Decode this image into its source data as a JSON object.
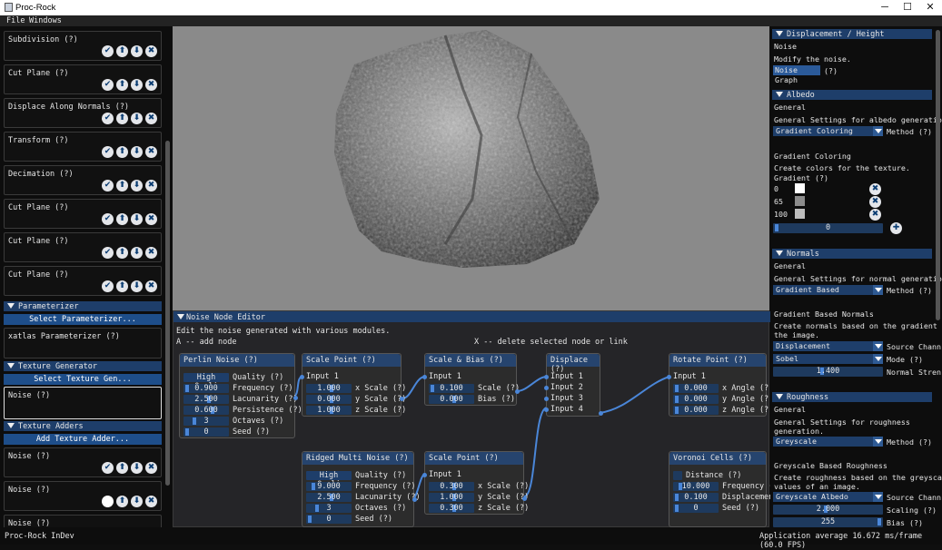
{
  "window": {
    "title": "Proc-Rock",
    "min": "─",
    "max": "☐",
    "close": "✕"
  },
  "menu": [
    "File",
    "Windows"
  ],
  "left": {
    "modifiers": [
      {
        "label": "Subdivision (?)"
      },
      {
        "label": "Cut Plane (?)"
      },
      {
        "label": "Displace Along Normals (?)"
      },
      {
        "label": "Transform (?)"
      },
      {
        "label": "Decimation (?)"
      },
      {
        "label": "Cut Plane (?)"
      },
      {
        "label": "Cut Plane (?)"
      },
      {
        "label": "Cut Plane (?)"
      }
    ],
    "parameterizer": {
      "title": "Parameterizer",
      "button": "Select Parameterizer...",
      "item": "xatlas Parameterizer (?)"
    },
    "texture_generator": {
      "title": "Texture Generator",
      "button": "Select Texture Gen...",
      "item": "Noise (?)"
    },
    "texture_adders": {
      "title": "Texture Adders",
      "button": "Add Texture Adder...",
      "items": [
        "Noise (?)",
        "Noise (?)",
        "Noise (?)"
      ]
    }
  },
  "node_editor": {
    "title": "Noise Node Editor",
    "description": "Edit the noise generated with various modules.",
    "hint_add": "A -- add node",
    "hint_delete": "X -- delete selected node or link",
    "perlin": {
      "title": "Perlin Noise (?)",
      "quality_value": "High Quali",
      "quality_label": "Quality (?)",
      "frequency": "0.900",
      "frequency_label": "Frequency (?)",
      "lacunarity": "2.500",
      "lacunarity_label": "Lacunarity (?)",
      "persistence": "0.600",
      "persistence_label": "Persistence (?)",
      "octaves": "3",
      "octaves_label": "Octaves (?)",
      "seed": "0",
      "seed_label": "Seed (?)"
    },
    "scale_point1": {
      "title": "Scale Point (?)",
      "input": "Input 1",
      "x": "1.000",
      "x_label": "x Scale (?)",
      "y": "0.000",
      "y_label": "y Scale (?)",
      "z": "1.000",
      "z_label": "z Scale (?)"
    },
    "scale_bias": {
      "title": "Scale & Bias (?)",
      "input": "Input 1",
      "scale": "0.100",
      "scale_label": "Scale (?)",
      "bias": "0.000",
      "bias_label": "Bias (?)"
    },
    "displace": {
      "title": "Displace (?)",
      "inputs": [
        "Input 1",
        "Input 2",
        "Input 3",
        "Input 4"
      ]
    },
    "rotate_point": {
      "title": "Rotate Point (?)",
      "input": "Input 1",
      "x": "0.000",
      "x_label": "x Angle (?",
      "y": "0.000",
      "y_label": "y Angle (?",
      "z": "0.000",
      "z_label": "z Angle (?"
    },
    "ridged": {
      "title": "Ridged Multi Noise (?)",
      "quality_value": "High Quali",
      "quality_label": "Quality (?)",
      "frequency": "9.000",
      "frequency_label": "Frequency (?)",
      "lacunarity": "2.500",
      "lacunarity_label": "Lacunarity (?)",
      "octaves": "3",
      "octaves_label": "Octaves (?)",
      "seed": "0",
      "seed_label": "Seed (?)"
    },
    "scale_point2": {
      "title": "Scale Point (?)",
      "input": "Input 1",
      "x": "0.300",
      "x_label": "x Scale (?)",
      "y": "1.000",
      "y_label": "y Scale (?)",
      "z": "0.300",
      "z_label": "z Scale (?)"
    },
    "voronoi": {
      "title": "Voronoi Cells (?)",
      "distance_label": "Distance (?)",
      "frequency": "10.000",
      "frequency_label": "Frequency (",
      "displacement": "0.100",
      "displacement_label": "Displacemen",
      "seed": "0",
      "seed_label": "Seed (?)"
    }
  },
  "right": {
    "displacement": {
      "title": "Displacement / Height",
      "name": "Noise",
      "desc": "Modify the noise.",
      "button": "Noise Graph",
      "help": "(?)"
    },
    "albedo": {
      "title": "Albedo",
      "general": "General",
      "general_desc": "General Settings for albedo generation.",
      "method_value": "Gradient Coloring",
      "method_label": "Method (?)",
      "gc_title": "Gradient Coloring",
      "gc_desc": "Create colors for the texture.",
      "gradient_label": "Gradient (?)",
      "stops": [
        {
          "pos": "0",
          "color": "#ffffff"
        },
        {
          "pos": "65",
          "color": "#8c8c8c"
        },
        {
          "pos": "100",
          "color": "#bdbdbd"
        }
      ],
      "slider_value": "0"
    },
    "normals": {
      "title": "Normals",
      "general": "General",
      "general_desc": "General Settings for normal generation.",
      "method_value": "Gradient Based",
      "method_label": "Method (?)",
      "gb_title": "Gradient Based Normals",
      "gb_desc1": "Create normals based on the gradient of",
      "gb_desc2": "the image.",
      "source_value": "Displacement",
      "source_label": "Source Chann",
      "mode_value": "Sobel",
      "mode_label": "Mode (?)",
      "strength_value": "1.400",
      "strength_label": "Normal Stren"
    },
    "roughness": {
      "title": "Roughness",
      "general": "General",
      "general_desc1": "General Settings for roughness",
      "general_desc2": "generation.",
      "method_value": "Greyscale",
      "method_label": "Method (?)",
      "gs_title": "Greyscale Based Roughness",
      "gs_desc1": "Create roughness based on the greyscale",
      "gs_desc2": "values of an image.",
      "source_value": "Greyscale Albedo",
      "source_label": "Source Chann",
      "scaling_value": "2.000",
      "scaling_label": "Scaling (?)",
      "bias_value": "255",
      "bias_label": "Bias (?)"
    }
  },
  "status": {
    "left": "Proc-Rock InDev",
    "right": "Application average 16.672 ms/frame (60.0 FPS)"
  }
}
